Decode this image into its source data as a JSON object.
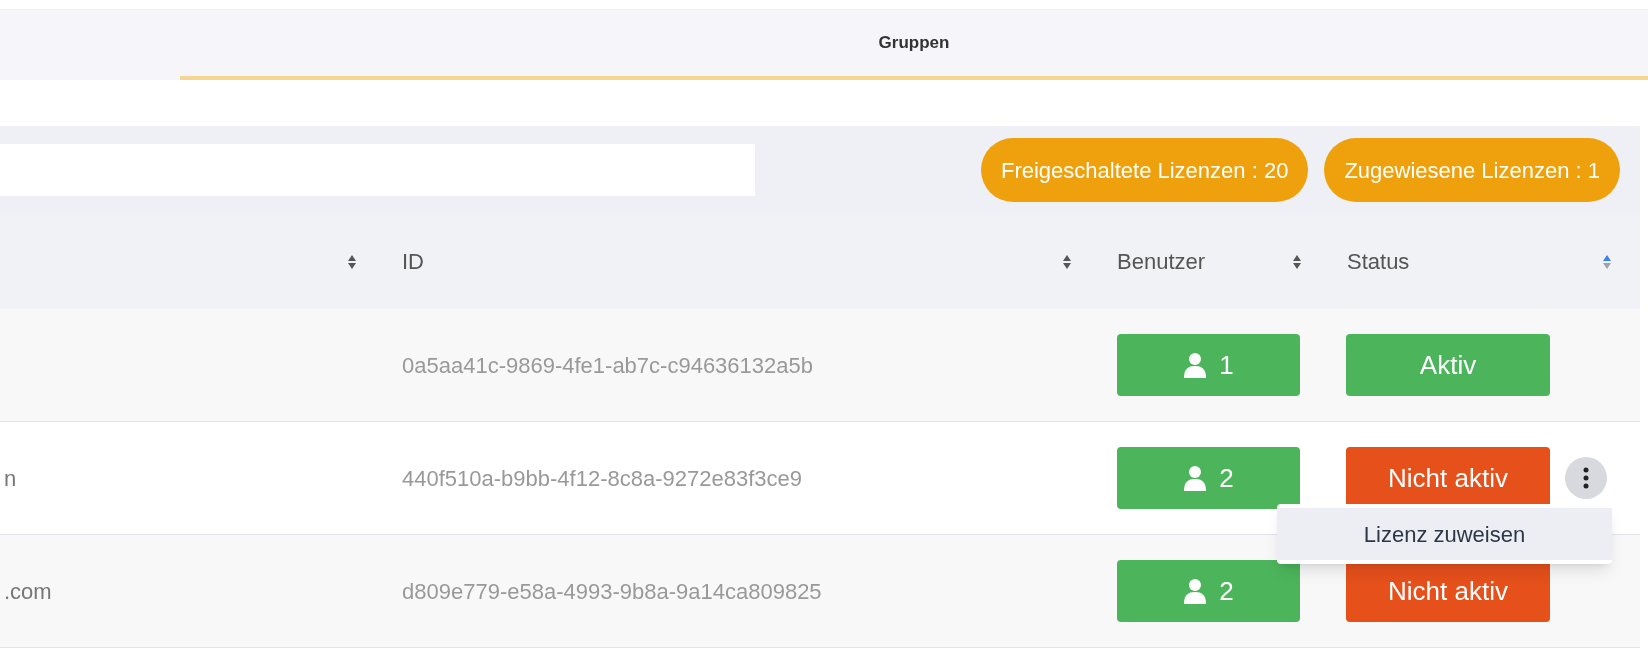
{
  "tabs": [
    {
      "label": "Gruppen",
      "selected": true
    }
  ],
  "badges": [
    "Freigeschaltete Lizenzen : 20",
    "Zugewiesene Lizenzen : 1"
  ],
  "columns": [
    {
      "sorted": false
    },
    {
      "label": "ID",
      "sorted": false
    },
    {
      "label": "Benutzer",
      "sorted": false
    },
    {
      "label": "Status",
      "sorted": true
    }
  ],
  "rows": [
    {
      "id": "0a5aa41c-9869-4fe1-ab7c-c94636132a5b",
      "users": "1",
      "status": "Aktiv",
      "active": true,
      "menu": false
    },
    {
      "name": "n",
      "id": "440f510a-b9bb-4f12-8c8a-9272e83f3ce9",
      "users": "2",
      "status": "Nicht aktiv",
      "active": false,
      "menu": true
    },
    {
      "name": ".com",
      "id": "d809e779-e58a-4993-9b8a-9a14ca809825",
      "users": "2",
      "status": "Nicht aktiv",
      "active": false,
      "menu": false
    }
  ],
  "context_menu": {
    "items": [
      "Lizenz zuweisen"
    ]
  }
}
